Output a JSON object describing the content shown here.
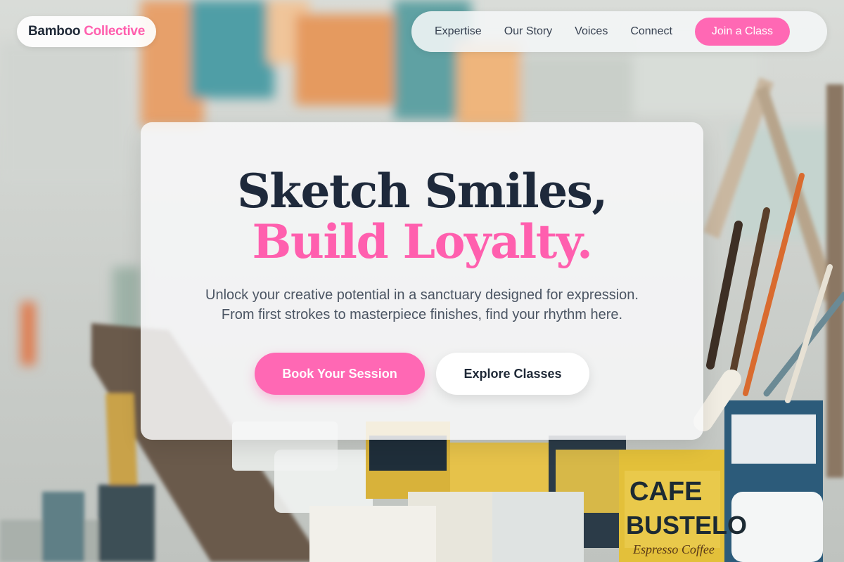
{
  "brand": {
    "name_part1": "Bamboo",
    "name_part2": "Collective",
    "accent_color": "#ff5fae"
  },
  "nav": {
    "links": [
      "Expertise",
      "Our Story",
      "Voices",
      "Connect"
    ],
    "cta_label": "Join a Class"
  },
  "hero": {
    "headline_line1": "Sketch Smiles,",
    "headline_line2": "Build Loyalty.",
    "subtext_line1": "Unlock your creative potential in a sanctuary designed for expression.",
    "subtext_line2": "From first strokes to masterpiece finishes, find your rhythm here.",
    "primary_button": "Book Your Session",
    "secondary_button": "Explore Classes"
  },
  "background": {
    "description_icon": "art-studio-photo",
    "can_label_1": "CAFE",
    "can_label_2": "BUSTELO",
    "can_label_3": "Espresso Coffee"
  },
  "colors": {
    "primary": "#ff68b4",
    "heading": "#1e293b",
    "body_text": "#4b5563"
  }
}
